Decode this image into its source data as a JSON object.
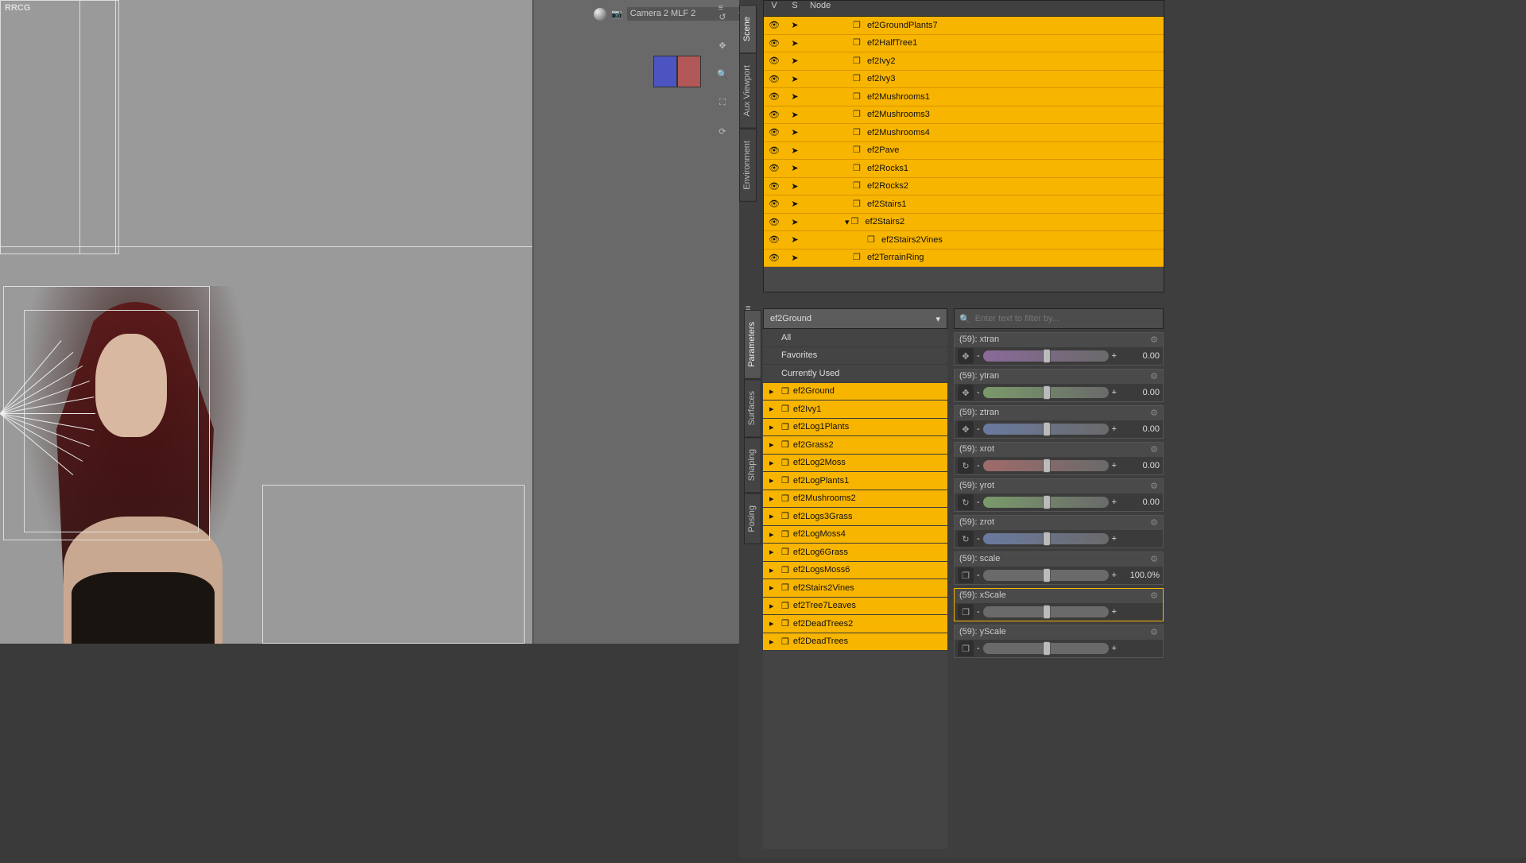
{
  "corner": "RRCG",
  "camera": {
    "icon": "camera-icon",
    "label": "Camera 2 MLF 2"
  },
  "sceneHeader": {
    "v": "V",
    "s": "S",
    "node": "Node"
  },
  "sceneItems": [
    {
      "indent": 60,
      "label": "ef2GroundPlants7"
    },
    {
      "indent": 60,
      "label": "ef2HalfTree1"
    },
    {
      "indent": 60,
      "label": "ef2Ivy2"
    },
    {
      "indent": 60,
      "label": "ef2Ivy3"
    },
    {
      "indent": 60,
      "label": "ef2Mushrooms1"
    },
    {
      "indent": 60,
      "label": "ef2Mushrooms3"
    },
    {
      "indent": 60,
      "label": "ef2Mushrooms4"
    },
    {
      "indent": 60,
      "label": "ef2Pave"
    },
    {
      "indent": 60,
      "label": "ef2Rocks1"
    },
    {
      "indent": 60,
      "label": "ef2Rocks2"
    },
    {
      "indent": 60,
      "label": "ef2Stairs1"
    },
    {
      "indent": 50,
      "label": "ef2Stairs2",
      "expand": true
    },
    {
      "indent": 78,
      "label": "ef2Stairs2Vines"
    },
    {
      "indent": 60,
      "label": "ef2TerrainRing"
    }
  ],
  "rightTabs": [
    "Scene",
    "Aux Viewport",
    "Environment"
  ],
  "lowerTabs": [
    "Parameters",
    "Surfaces",
    "Shaping",
    "Posing"
  ],
  "llDropdown": "ef2Ground",
  "llItems": [
    {
      "label": "All",
      "sel": false,
      "icon": false
    },
    {
      "label": "Favorites",
      "sel": false,
      "icon": false
    },
    {
      "label": "Currently Used",
      "sel": false,
      "icon": false
    },
    {
      "label": "ef2Ground",
      "sel": true,
      "icon": true
    },
    {
      "label": "ef2Ivy1",
      "sel": true,
      "icon": true
    },
    {
      "label": "ef2Log1Plants",
      "sel": true,
      "icon": true
    },
    {
      "label": "ef2Grass2",
      "sel": true,
      "icon": true
    },
    {
      "label": "ef2Log2Moss",
      "sel": true,
      "icon": true
    },
    {
      "label": "ef2LogPlants1",
      "sel": true,
      "icon": true
    },
    {
      "label": "ef2Mushrooms2",
      "sel": true,
      "icon": true
    },
    {
      "label": "ef2Logs3Grass",
      "sel": true,
      "icon": true
    },
    {
      "label": "ef2LogMoss4",
      "sel": true,
      "icon": true
    },
    {
      "label": "ef2Log6Grass",
      "sel": true,
      "icon": true
    },
    {
      "label": "ef2LogsMoss6",
      "sel": true,
      "icon": true
    },
    {
      "label": "ef2Stairs2Vines",
      "sel": true,
      "icon": true
    },
    {
      "label": "ef2Tree7Leaves",
      "sel": true,
      "icon": true
    },
    {
      "label": "ef2DeadTrees2",
      "sel": true,
      "icon": true
    },
    {
      "label": "ef2DeadTrees",
      "sel": true,
      "icon": true
    }
  ],
  "filterPlaceholder": "Enter text to filter by...",
  "params": [
    {
      "name": "xtran",
      "count": "(59)",
      "value": "0.00",
      "color": "purple",
      "icon": "move"
    },
    {
      "name": "ytran",
      "count": "(59)",
      "value": "0.00",
      "color": "green",
      "icon": "move"
    },
    {
      "name": "ztran",
      "count": "(59)",
      "value": "0.00",
      "color": "blue",
      "icon": "move"
    },
    {
      "name": "xrot",
      "count": "(59)",
      "value": "0.00",
      "color": "red",
      "icon": "rot"
    },
    {
      "name": "yrot",
      "count": "(59)",
      "value": "0.00",
      "color": "green",
      "icon": "rot"
    },
    {
      "name": "zrot",
      "count": "(59)",
      "value": "",
      "color": "blue",
      "icon": "rot"
    },
    {
      "name": "scale",
      "count": "(59)",
      "value": "100.0%",
      "color": "",
      "icon": "scale"
    },
    {
      "name": "xScale",
      "count": "(59)",
      "value": "",
      "color": "",
      "icon": "scale",
      "hl": true
    },
    {
      "name": "yScale",
      "count": "(59)",
      "value": "",
      "color": "",
      "icon": "scale"
    }
  ]
}
